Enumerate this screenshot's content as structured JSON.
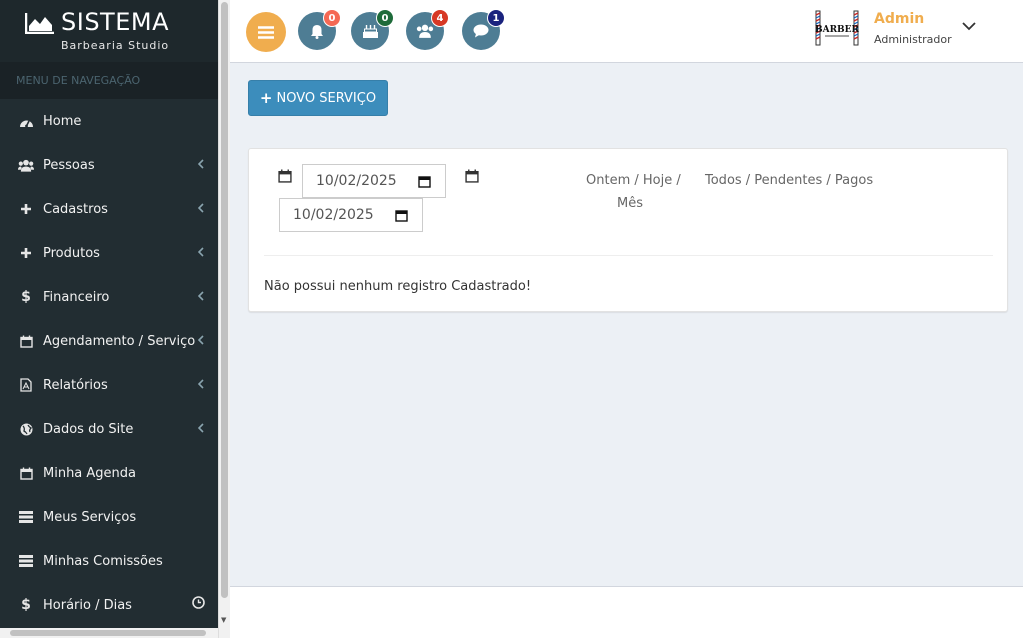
{
  "brand": {
    "title": "SISTEMA",
    "subtitle": "Barbearia Studio"
  },
  "sidebar": {
    "header": "MENU DE NAVEGAÇÃO",
    "items": [
      {
        "label": "Home",
        "icon": "dashboard-icon",
        "has_arrow": false
      },
      {
        "label": "Pessoas",
        "icon": "users-icon",
        "has_arrow": true
      },
      {
        "label": "Cadastros",
        "icon": "plus-icon",
        "has_arrow": true
      },
      {
        "label": "Produtos",
        "icon": "plus-icon",
        "has_arrow": true
      },
      {
        "label": "Financeiro",
        "icon": "dollar-icon",
        "has_arrow": true
      },
      {
        "label": "Agendamento / Serviço",
        "icon": "calendar-icon",
        "has_arrow": true
      },
      {
        "label": "Relatórios",
        "icon": "pdf-file-icon",
        "has_arrow": true
      },
      {
        "label": "Dados do Site",
        "icon": "globe-icon",
        "has_arrow": true
      },
      {
        "label": "Minha Agenda",
        "icon": "calendar-icon",
        "has_arrow": false
      },
      {
        "label": "Meus Serviços",
        "icon": "server-icon",
        "has_arrow": false
      },
      {
        "label": "Minhas Comissões",
        "icon": "server-icon",
        "has_arrow": false
      },
      {
        "label": "Horário / Dias",
        "icon": "dollar-icon",
        "has_arrow": false,
        "extra_icon": "clock-icon"
      }
    ]
  },
  "topbar": {
    "notifications": [
      {
        "icon": "bell-icon",
        "count": "0",
        "badge_color": "#f56954"
      },
      {
        "icon": "birthday-cake-icon",
        "count": "0",
        "badge_color": "#1e6b3a"
      },
      {
        "icon": "users-icon",
        "count": "4",
        "badge_color": "#d73925"
      },
      {
        "icon": "comment-icon",
        "count": "1",
        "badge_color": "#1a237e"
      }
    ],
    "user": {
      "name": "Admin",
      "role": "Administrador",
      "logo_text": "BARBER"
    }
  },
  "content": {
    "new_button": "NOVO SERVIÇO",
    "date_start": "10/02/2025",
    "date_end": "10/02/2025",
    "period_filter_line1": "Ontem / Hoje /",
    "period_filter_line2": "Mês",
    "status_filter": "Todos / Pendentes / Pagos",
    "empty_message": "Não possui nenhum registro Cadastrado!"
  },
  "colors": {
    "sidebar_bg": "#222d32",
    "accent_orange": "#f0ad4e",
    "primary_blue": "#3c8dbc",
    "icon_button": "#4e7d94"
  }
}
